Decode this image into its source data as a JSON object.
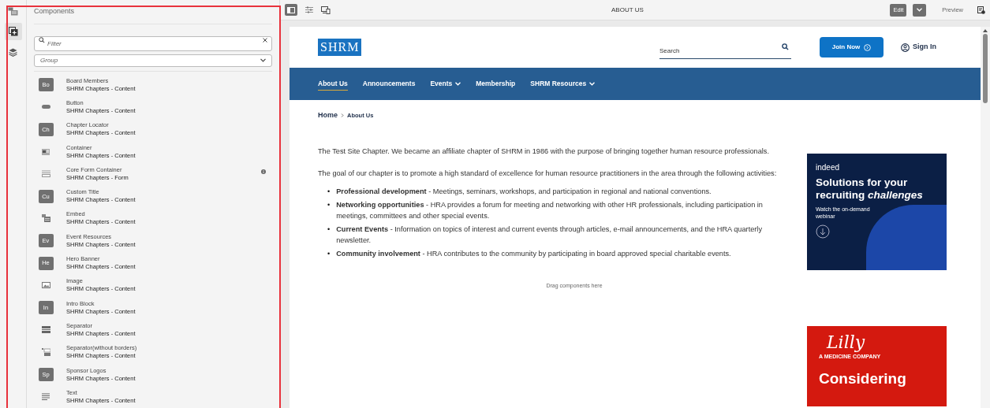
{
  "rail": [
    {
      "selected": false
    },
    {
      "selected": true
    },
    {
      "selected": false
    }
  ],
  "panel": {
    "title": "Components",
    "filter": {
      "placeholder": "Filter"
    },
    "group": {
      "placeholder": "Group"
    },
    "items": [
      {
        "name": "Board Members",
        "group": "SHRM Chapters - Content",
        "kind": "badge",
        "badge": "Bo",
        "has_info": false
      },
      {
        "name": "Button",
        "group": "SHRM Chapters - Content",
        "kind": "icon",
        "has_info": false
      },
      {
        "name": "Chapter Locator",
        "group": "SHRM Chapters - Content",
        "kind": "badge",
        "badge": "Ch",
        "has_info": false
      },
      {
        "name": "Container",
        "group": "SHRM Chapters - Content",
        "kind": "icon",
        "has_info": false
      },
      {
        "name": "Core Form Container",
        "group": "SHRM Chapters - Form",
        "kind": "icon",
        "has_info": true
      },
      {
        "name": "Custom Title",
        "group": "SHRM Chapters - Content",
        "kind": "badge",
        "badge": "Cu",
        "has_info": false
      },
      {
        "name": "Embed",
        "group": "SHRM Chapters - Content",
        "kind": "icon",
        "has_info": false
      },
      {
        "name": "Event Resources",
        "group": "SHRM Chapters - Content",
        "kind": "badge",
        "badge": "Ev",
        "has_info": false
      },
      {
        "name": "Hero Banner",
        "group": "SHRM Chapters - Content",
        "kind": "badge",
        "badge": "He",
        "has_info": false
      },
      {
        "name": "Image",
        "group": "SHRM Chapters - Content",
        "kind": "icon",
        "has_info": false
      },
      {
        "name": "Intro Block",
        "group": "SHRM Chapters - Content",
        "kind": "badge",
        "badge": "In",
        "has_info": false
      },
      {
        "name": "Separator",
        "group": "SHRM Chapters - Content",
        "kind": "icon",
        "has_info": false
      },
      {
        "name": "Separator(without borders)",
        "group": "SHRM Chapters - Content",
        "kind": "icon",
        "has_info": false
      },
      {
        "name": "Sponsor Logos",
        "group": "SHRM Chapters - Content",
        "kind": "badge",
        "badge": "Sp",
        "has_info": false
      },
      {
        "name": "Text",
        "group": "SHRM Chapters - Content",
        "kind": "icon",
        "has_info": false
      }
    ]
  },
  "toolbar": {
    "title": "ABOUT US",
    "modes": [
      {
        "label": "Edit",
        "selected": true
      },
      {
        "label": "Preview",
        "selected": false
      }
    ]
  },
  "site": {
    "logo": "SHRM",
    "search": {
      "placeholder": "Search"
    },
    "join_button": "Join Now",
    "sign_in": "Sign In",
    "nav": [
      {
        "label": "About Us",
        "selected": true,
        "dropdown": false
      },
      {
        "label": "Announcements",
        "selected": false,
        "dropdown": false
      },
      {
        "label": "Events",
        "selected": false,
        "dropdown": true
      },
      {
        "label": "Membership",
        "selected": false,
        "dropdown": false
      },
      {
        "label": "SHRM Resources",
        "selected": false,
        "dropdown": true
      }
    ],
    "breadcrumb": [
      "Home",
      "About Us"
    ],
    "paragraphs": [
      "The Test Site Chapter. We became an affiliate chapter of SHRM in 1986 with the purpose of bringing together human resource professionals.",
      "The goal of our chapter is to promote a high standard of excellence for human resource practitioners in the area through the following activities:"
    ],
    "bullets": [
      {
        "marker": "•",
        "text": "**Professional development** - Meetings, seminars, workshops, and participation in regional and national conventions."
      },
      {
        "marker": "•",
        "text": "**Networking opportunities** - HRA provides a forum for meeting and networking with other HR professionals, including participation in meetings, committees and other special events."
      },
      {
        "marker": "•",
        "text": "**Current Events** - Information on topics of interest and current events through articles, e-mail announcements, and the HRA quarterly newsletter."
      },
      {
        "marker": "•",
        "text": "**Community involvement** - HRA contributes to the community by participating in board approved special charitable events."
      }
    ],
    "drop_hint": "Drag components here",
    "ads": [
      {
        "kind": "indeed",
        "brand": "indeed",
        "headline": "Solutions for your recruiting *challenges*",
        "sub": "Watch the on-demand webinar"
      },
      {
        "kind": "lilly",
        "brand": "Lilly",
        "sub": "A MEDICINE COMPANY",
        "headline": "Considering"
      }
    ]
  }
}
